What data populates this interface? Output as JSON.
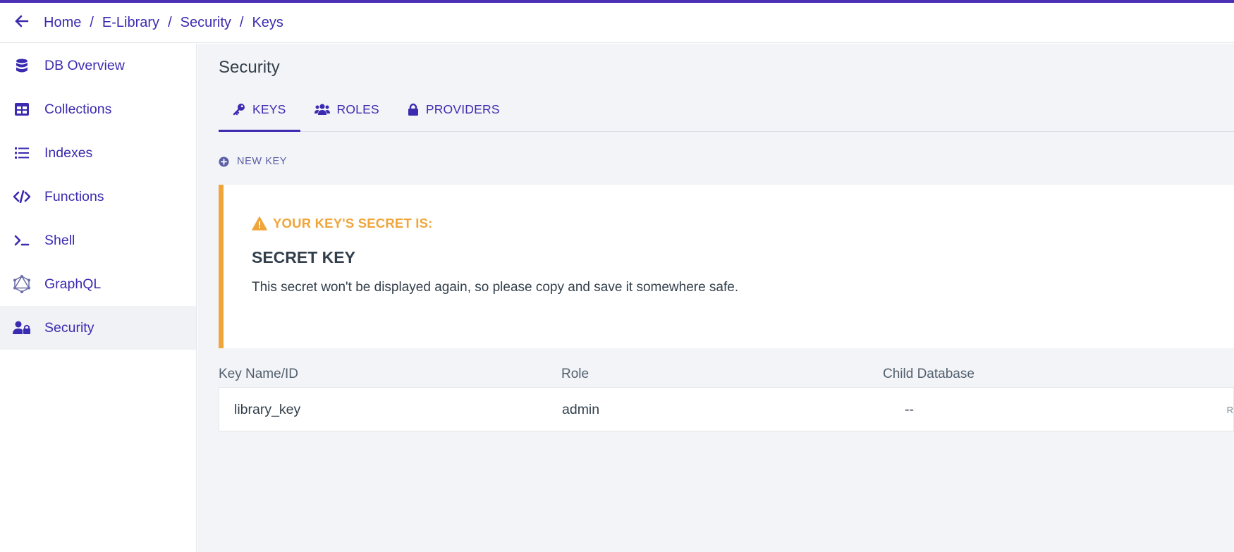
{
  "header": {
    "back_label": "back",
    "breadcrumb": [
      "Home",
      "E-Library",
      "Security",
      "Keys"
    ],
    "separator": "/"
  },
  "sidebar": {
    "items": [
      {
        "label": "DB Overview",
        "icon": "database-icon"
      },
      {
        "label": "Collections",
        "icon": "table-icon"
      },
      {
        "label": "Indexes",
        "icon": "list-icon"
      },
      {
        "label": "Functions",
        "icon": "code-icon"
      },
      {
        "label": "Shell",
        "icon": "terminal-icon"
      },
      {
        "label": "GraphQL",
        "icon": "graphql-icon"
      },
      {
        "label": "Security",
        "icon": "user-lock-icon",
        "active": true
      }
    ]
  },
  "main": {
    "title": "Security",
    "tabs": [
      {
        "label": "KEYS",
        "icon": "key-icon",
        "active": true
      },
      {
        "label": "ROLES",
        "icon": "users-icon"
      },
      {
        "label": "PROVIDERS",
        "icon": "lock-icon"
      }
    ],
    "new_key_label": "NEW KEY",
    "alert": {
      "heading": "YOUR KEY'S SECRET IS:",
      "title": "SECRET KEY",
      "body": "This secret won't be displayed again, so please copy and save it somewhere safe."
    },
    "table": {
      "columns": [
        "Key Name/ID",
        "Role",
        "Child Database"
      ],
      "rows": [
        {
          "name": "library_key",
          "role": "admin",
          "child_database": "--",
          "action_cut": "R"
        }
      ]
    }
  },
  "colors": {
    "accent": "#3b2bb0",
    "top_bar": "#4b2fb5",
    "warning": "#f0a53a",
    "main_bg": "#f3f4f8"
  }
}
